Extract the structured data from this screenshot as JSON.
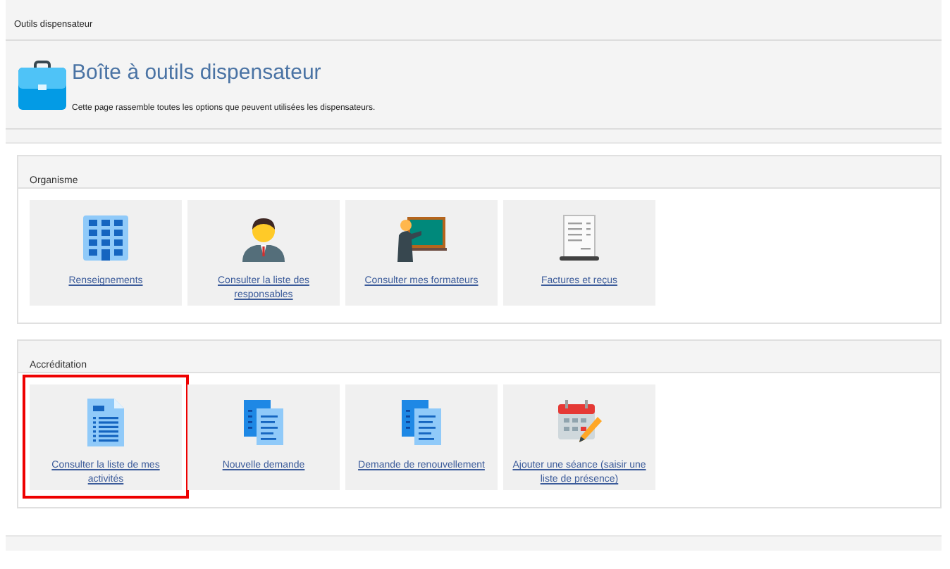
{
  "breadcrumb": "Outils dispensateur",
  "header": {
    "title": "Boîte à outils dispensateur",
    "description": "Cette page rassemble toutes les options que peuvent utilisées les dispensateurs."
  },
  "sections": [
    {
      "title": "Organisme",
      "tiles": [
        {
          "kind": "building",
          "label": "Renseignements",
          "highlighted": false
        },
        {
          "kind": "person",
          "label": "Consulter la liste des responsables",
          "highlighted": false
        },
        {
          "kind": "teacher",
          "label": "Consulter mes formateurs",
          "highlighted": false
        },
        {
          "kind": "receipt",
          "label": "Factures et reçus",
          "highlighted": false
        }
      ]
    },
    {
      "title": "Accréditation",
      "tiles": [
        {
          "kind": "document",
          "label": "Consulter la liste de mes activités",
          "highlighted": true
        },
        {
          "kind": "documents",
          "label": "Nouvelle demande",
          "highlighted": false
        },
        {
          "kind": "documents",
          "label": "Demande de renouvellement",
          "highlighted": false
        },
        {
          "kind": "calendar",
          "label": "Ajouter une séance (saisir une liste de présence)",
          "highlighted": false
        }
      ]
    }
  ]
}
